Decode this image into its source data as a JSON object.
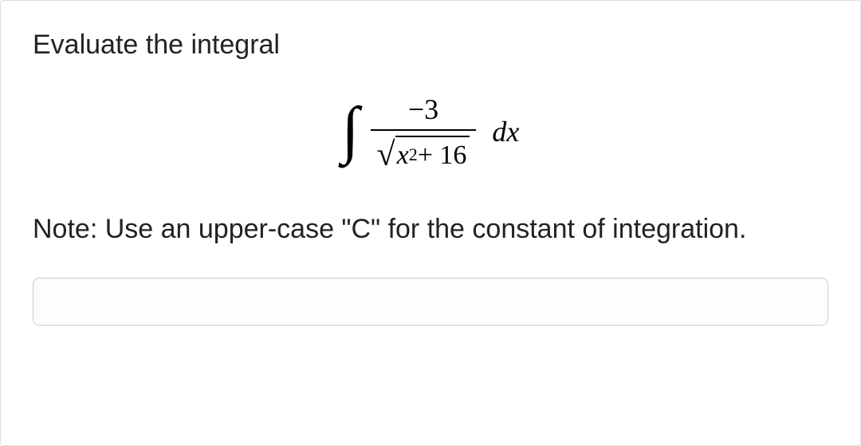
{
  "problem": {
    "prompt": "Evaluate the integral",
    "integral": {
      "numerator": "−3",
      "denom_inside_sqrt_var": "x",
      "denom_inside_sqrt_exp": "2",
      "denom_inside_sqrt_plus": " + 16",
      "differential": "dx"
    },
    "note": "Note: Use an upper-case \"C\" for the constant of integration."
  },
  "answer": {
    "value": "",
    "placeholder": ""
  }
}
